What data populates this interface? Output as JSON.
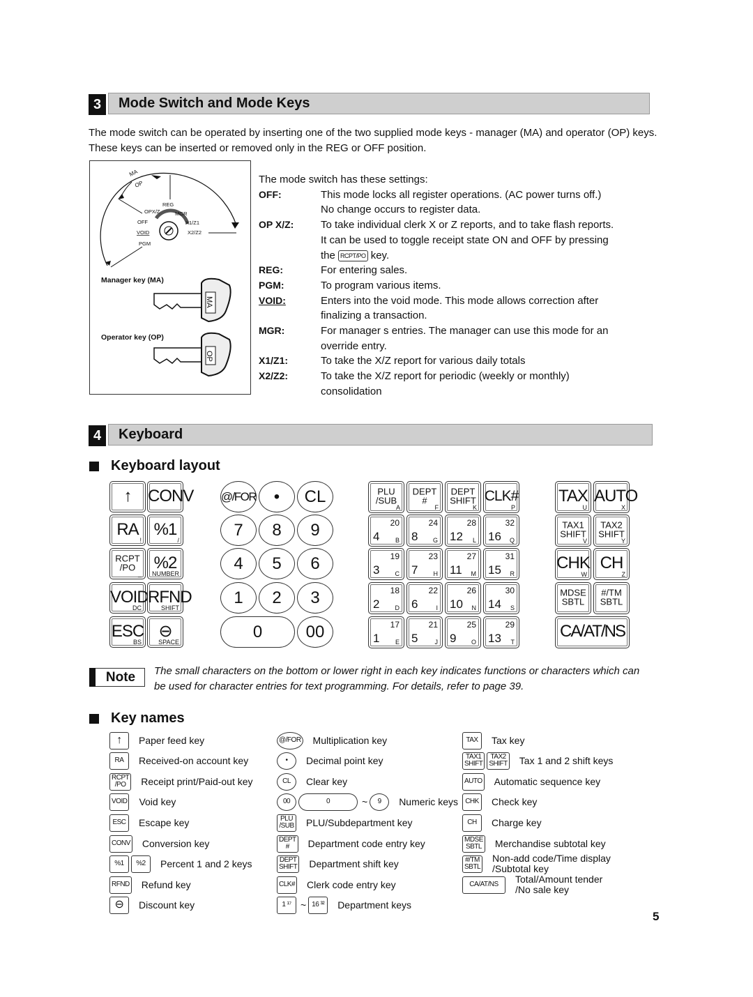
{
  "section3": {
    "number": "3",
    "title": "Mode Switch and Mode Keys"
  },
  "intro": "The mode switch can be operated by inserting one of the two supplied mode keys - manager (MA) and operator (OP) keys.  These keys can be inserted or removed only in the  REG  or  OFF  position.",
  "diagram": {
    "ma": "MA",
    "op": "OP",
    "reg": "REG",
    "opxz": "OPX/Z",
    "mgr": "MGR",
    "off": "OFF",
    "x1z1": "X1/Z1",
    "void": "VOID",
    "x2z2": "X2/Z2",
    "pgm": "PGM",
    "manager_key": "Manager key (MA)",
    "operator_key": "Operator key (OP)",
    "ma_tag": "MA",
    "op_tag": "OP"
  },
  "settings": {
    "intro": "The mode switch has these settings:",
    "rows": [
      {
        "label": "OFF:",
        "desc": "This mode locks all register operations. (AC power turns off.)"
      },
      {
        "label": "",
        "desc": "No change occurs to register data."
      },
      {
        "label": "OP X/Z:",
        "desc": "To take individual clerk X or Z reports, and to take flash reports."
      },
      {
        "label": "",
        "desc": "It can be used to toggle receipt state  ON  and  OFF  by pressing"
      },
      {
        "label": "",
        "desc": "the",
        "key": "RCPT/PO",
        "after": " key."
      },
      {
        "label": "REG:",
        "desc": "For entering sales."
      },
      {
        "label": "PGM:",
        "desc": "To program various items."
      },
      {
        "label": "VOID:",
        "desc": "Enters into the void mode.  This mode allows correction after",
        "underline": true
      },
      {
        "label": "",
        "desc": "finalizing a transaction."
      },
      {
        "label": "MGR:",
        "desc": "For manager s entries.  The manager can use this mode for an"
      },
      {
        "label": "",
        "desc": "override entry."
      },
      {
        "label": "X1/Z1:",
        "desc": "To take the X/Z report for various daily totals"
      },
      {
        "label": "X2/Z2:",
        "desc": "To take the X/Z report for periodic (weekly or monthly)"
      },
      {
        "label": "",
        "desc": "consolidation"
      }
    ]
  },
  "section4": {
    "number": "4",
    "title": "Keyboard"
  },
  "keyboard_layout_title": "Keyboard layout",
  "keyboard": {
    "left": [
      {
        "main": "↑",
        "sub": ""
      },
      {
        "main": "CONV",
        "sub": ""
      },
      {
        "main": "RA",
        "sub": "!"
      },
      {
        "main": "%1",
        "sub": "/"
      },
      {
        "main": "RCPT\n/PO",
        "sub": "_"
      },
      {
        "main": "%2",
        "sub": "NUMBER"
      },
      {
        "main": "VOID",
        "sub": "DC"
      },
      {
        "main": "RFND",
        "sub": "SHIFT"
      },
      {
        "main": "ESC",
        "sub": "BS"
      },
      {
        "main": "⊖",
        "sub": "SPACE"
      }
    ],
    "numeric": [
      "@/FOR",
      "•",
      "CL",
      "7",
      "8",
      "9",
      "4",
      "5",
      "6",
      "1",
      "2",
      "3",
      "0",
      "00"
    ],
    "dept_top": [
      {
        "main": "PLU\n/SUB",
        "sub": "A"
      },
      {
        "main": "DEPT\n#",
        "sub": "F"
      },
      {
        "main": "DEPT\nSHIFT",
        "sub": "K"
      },
      {
        "main": "CLK#",
        "sub": "P"
      }
    ],
    "dept_grid": [
      [
        {
          "n": "4",
          "t": "20",
          "l": "B"
        },
        {
          "n": "8",
          "t": "24",
          "l": "G"
        },
        {
          "n": "12",
          "t": "28",
          "l": "L"
        },
        {
          "n": "16",
          "t": "32",
          "l": "Q"
        }
      ],
      [
        {
          "n": "3",
          "t": "19",
          "l": "C"
        },
        {
          "n": "7",
          "t": "23",
          "l": "H"
        },
        {
          "n": "11",
          "t": "27",
          "l": "M"
        },
        {
          "n": "15",
          "t": "31",
          "l": "R"
        }
      ],
      [
        {
          "n": "2",
          "t": "18",
          "l": "D"
        },
        {
          "n": "6",
          "t": "22",
          "l": "I"
        },
        {
          "n": "10",
          "t": "26",
          "l": "N"
        },
        {
          "n": "14",
          "t": "30",
          "l": "S"
        }
      ],
      [
        {
          "n": "1",
          "t": "17",
          "l": "E"
        },
        {
          "n": "5",
          "t": "21",
          "l": "J"
        },
        {
          "n": "9",
          "t": "25",
          "l": "O"
        },
        {
          "n": "13",
          "t": "29",
          "l": "T"
        }
      ]
    ],
    "right": [
      {
        "main": "TAX",
        "sub": "U"
      },
      {
        "main": "AUTO",
        "sub": "X"
      },
      {
        "main": "TAX1\nSHIFT",
        "sub": "V"
      },
      {
        "main": "TAX2\nSHIFT",
        "sub": "Y"
      },
      {
        "main": "CHK",
        "sub": "W"
      },
      {
        "main": "CH",
        "sub": "Z"
      },
      {
        "main": "MDSE\nSBTL",
        "sub": ""
      },
      {
        "main": "#/TM\nSBTL",
        "sub": ""
      },
      {
        "main": "CA/AT/NS",
        "sub": ""
      }
    ]
  },
  "note": {
    "badge": "Note",
    "text": "The small characters on the bottom or lower right in each key indicates functions or characters which can be used for character entries for text programming.  For details, refer to page 39."
  },
  "key_names_title": "Key names",
  "key_names": [
    [
      {
        "keys": [
          "↑"
        ],
        "desc": "Paper feed key"
      },
      {
        "keys": [
          "RA"
        ],
        "desc": "Received-on account key"
      },
      {
        "keys": [
          "RCPT\n/PO"
        ],
        "desc": "Receipt print/Paid-out key"
      },
      {
        "keys": [
          "VOID"
        ],
        "desc": "Void key"
      },
      {
        "keys": [
          "ESC"
        ],
        "desc": "Escape key"
      },
      {
        "keys": [
          "CONV"
        ],
        "desc": "Conversion key"
      },
      {
        "keys": [
          "%1",
          "%2"
        ],
        "desc": "Percent 1 and 2 keys"
      },
      {
        "keys": [
          "RFND"
        ],
        "desc": "Refund key"
      },
      {
        "keys": [
          "⊖"
        ],
        "desc": "Discount key"
      }
    ],
    [
      {
        "keys": [
          "@/FOR"
        ],
        "desc": "Multiplication key",
        "shape": "round"
      },
      {
        "keys": [
          "•"
        ],
        "desc": "Decimal point key",
        "shape": "round"
      },
      {
        "keys": [
          "CL"
        ],
        "desc": "Clear key",
        "shape": "round"
      },
      {
        "keys": [
          "00",
          "0",
          "~",
          "9"
        ],
        "desc": "Numeric keys",
        "shape": "numeric"
      },
      {
        "keys": [
          "PLU\n/SUB"
        ],
        "desc": "PLU/Subdepartment key"
      },
      {
        "keys": [
          "DEPT\n#"
        ],
        "desc": "Department code entry key"
      },
      {
        "keys": [
          "DEPT\nSHIFT"
        ],
        "desc": "Department shift key"
      },
      {
        "keys": [
          "CLK#"
        ],
        "desc": "Clerk code entry key"
      },
      {
        "keys": [
          "1 ¹⁷",
          "~",
          "16 ³²"
        ],
        "desc": "Department keys",
        "shape": "dept"
      }
    ],
    [
      {
        "keys": [
          "TAX"
        ],
        "desc": "Tax key"
      },
      {
        "keys": [
          "TAX1\nSHIFT",
          "TAX2\nSHIFT"
        ],
        "desc": "Tax 1 and 2 shift keys"
      },
      {
        "keys": [
          "AUTO"
        ],
        "desc": "Automatic sequence key"
      },
      {
        "keys": [
          "CHK"
        ],
        "desc": "Check key"
      },
      {
        "keys": [
          "CH"
        ],
        "desc": "Charge key"
      },
      {
        "keys": [
          "MDSE\nSBTL"
        ],
        "desc": "Merchandise subtotal key"
      },
      {
        "keys": [
          "#/TM\nSBTL"
        ],
        "desc": "Non-add code/Time display\n/Subtotal key"
      },
      {
        "keys": [
          "CA/AT/NS"
        ],
        "desc": "Total/Amount tender\n/No sale key",
        "shape": "wide"
      }
    ]
  ],
  "page_number": "5"
}
